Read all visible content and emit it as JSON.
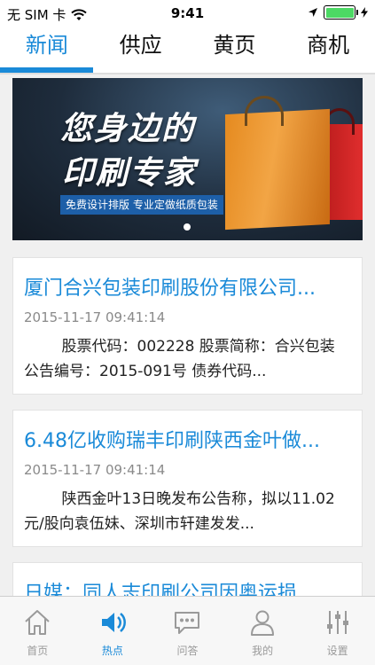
{
  "status_bar": {
    "carrier": "无 SIM 卡",
    "time": "9:41",
    "icons": [
      "wifi-icon",
      "location-arrow-icon",
      "battery-charging-icon"
    ]
  },
  "top_tabs": [
    {
      "label": "新闻",
      "active": true
    },
    {
      "label": "供应",
      "active": false
    },
    {
      "label": "黄页",
      "active": false
    },
    {
      "label": "商机",
      "active": false
    }
  ],
  "banner": {
    "headline_line1": "您身边的",
    "headline_line2": "印刷专家",
    "subtitle": "免费设计排版  专业定做纸质包装",
    "slide_count": 1,
    "active_slide": 1
  },
  "news": [
    {
      "title": "厦门合兴包装印刷股份有限公司...",
      "date": "2015-11-17 09:41:14",
      "summary": "股票代码：002228 股票简称：合兴包装 公告编号：2015-091号 债券代码..."
    },
    {
      "title": "6.48亿收购瑞丰印刷陕西金叶做...",
      "date": "2015-11-17 09:41:14",
      "summary": "陕西金叶13日晚发布公告称，拟以11.02元/股向袁伍妹、深圳市轩建发发..."
    },
    {
      "title": "日媒：同人志印刷公司因奥运损..."
    }
  ],
  "bottom_nav": [
    {
      "label": "首页",
      "icon": "home-icon",
      "active": false
    },
    {
      "label": "热点",
      "icon": "speaker-icon",
      "active": true
    },
    {
      "label": "问答",
      "icon": "chat-bubble-icon",
      "active": false
    },
    {
      "label": "我的",
      "icon": "person-icon",
      "active": false
    },
    {
      "label": "设置",
      "icon": "sliders-icon",
      "active": false
    }
  ],
  "colors": {
    "accent": "#1a8ad8",
    "inactive": "#9a9a9a"
  }
}
